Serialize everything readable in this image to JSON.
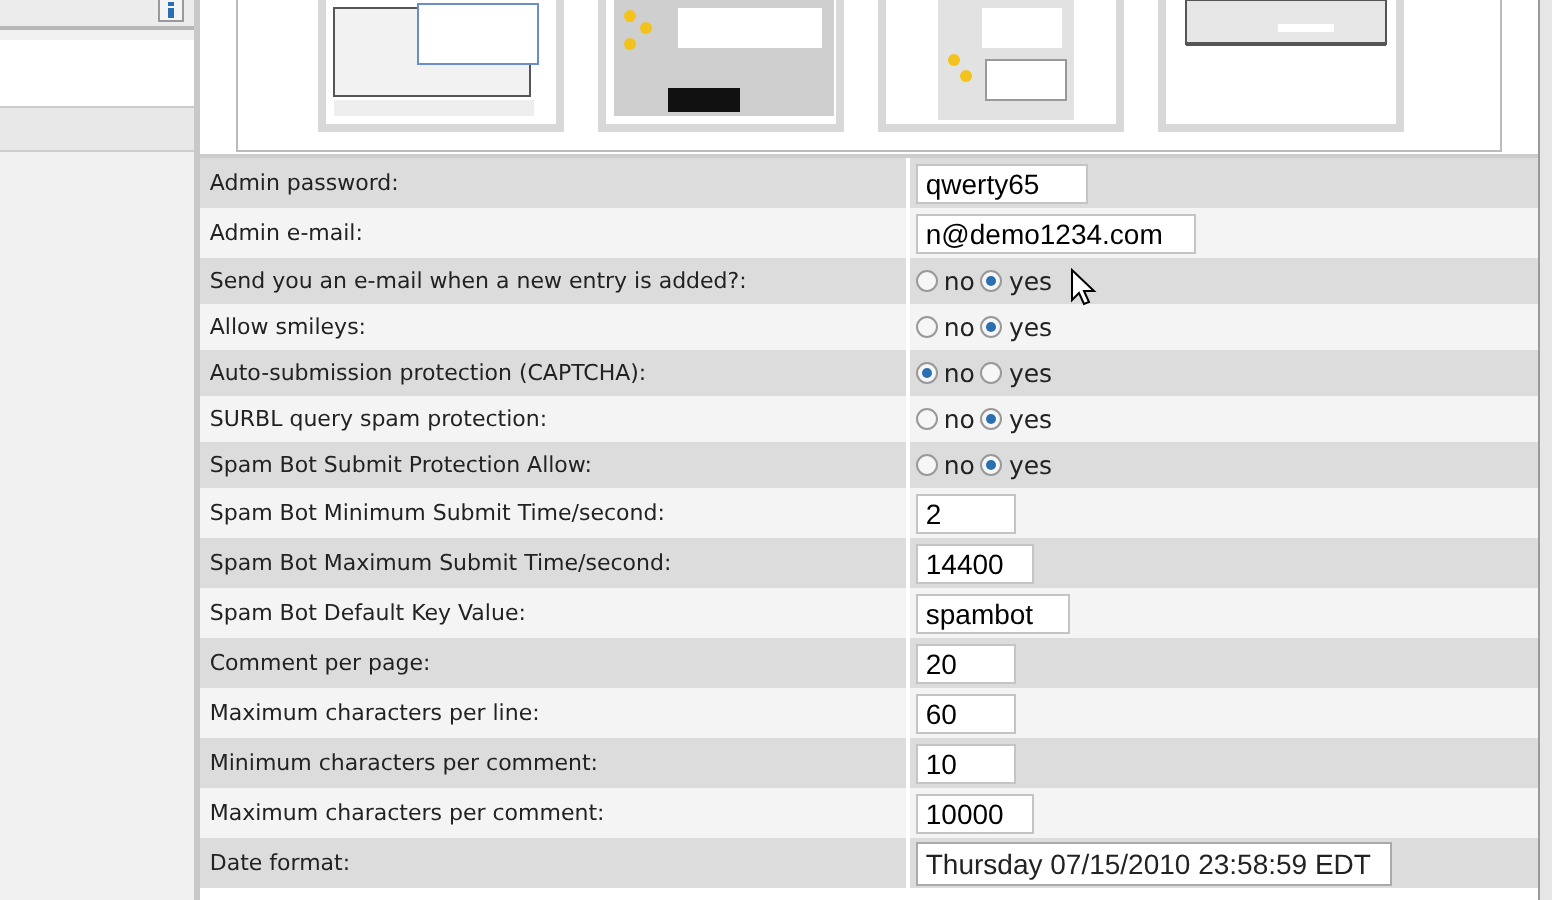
{
  "settings": [
    {
      "kind": "text",
      "label": "Admin password:",
      "value": "qwerty65"
    },
    {
      "kind": "text",
      "label": "Admin e-mail:",
      "value": "n@demo1234.com"
    },
    {
      "kind": "radio",
      "label": "Send you an e-mail when a new entry is added?:",
      "options": [
        {
          "label": "no",
          "selected": false
        },
        {
          "label": "yes",
          "selected": true
        }
      ],
      "hovered": true
    },
    {
      "kind": "radio",
      "label": "Allow smileys:",
      "options": [
        {
          "label": "no",
          "selected": false
        },
        {
          "label": "yes",
          "selected": true
        }
      ]
    },
    {
      "kind": "radio",
      "label": "Auto-submission protection (CAPTCHA):",
      "options": [
        {
          "label": "no",
          "selected": true
        },
        {
          "label": "yes",
          "selected": false
        }
      ]
    },
    {
      "kind": "radio",
      "label": "SURBL query spam protection:",
      "options": [
        {
          "label": "no",
          "selected": false
        },
        {
          "label": "yes",
          "selected": true
        }
      ]
    },
    {
      "kind": "radio",
      "label": "Spam Bot Submit Protection Allow:",
      "options": [
        {
          "label": "no",
          "selected": false
        },
        {
          "label": "yes",
          "selected": true
        }
      ]
    },
    {
      "kind": "text",
      "label": "Spam Bot Minimum Submit Time/second:",
      "value": "2"
    },
    {
      "kind": "text",
      "label": "Spam Bot Maximum Submit Time/second:",
      "value": "14400"
    },
    {
      "kind": "text",
      "label": "Spam Bot Default Key Value:",
      "value": "spambot"
    },
    {
      "kind": "text",
      "label": "Comment per page:",
      "value": "20"
    },
    {
      "kind": "text",
      "label": "Maximum characters per line:",
      "value": "60"
    },
    {
      "kind": "text",
      "label": "Minimum characters per comment:",
      "value": "10"
    },
    {
      "kind": "text",
      "label": "Maximum characters per comment:",
      "value": "10000"
    },
    {
      "kind": "select",
      "label": "Date format:",
      "value": "Thursday 07/15/2010 23:58:59 EDT"
    }
  ]
}
